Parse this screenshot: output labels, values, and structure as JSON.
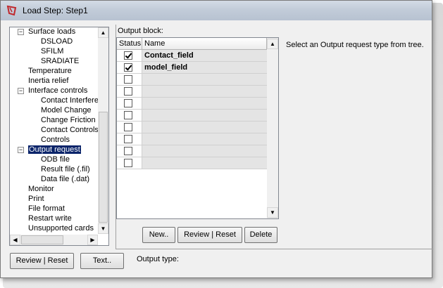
{
  "window": {
    "title": "Load Step: Step1"
  },
  "tree": {
    "items": [
      {
        "label": "Surface loads",
        "expander": "−"
      },
      {
        "label": "DSLOAD"
      },
      {
        "label": "SFILM"
      },
      {
        "label": "SRADIATE"
      },
      {
        "label": "Temperature"
      },
      {
        "label": "Inertia relief"
      },
      {
        "label": "Interface controls",
        "expander": "−"
      },
      {
        "label": "Contact Interfere"
      },
      {
        "label": "Model Change"
      },
      {
        "label": "Change Friction"
      },
      {
        "label": "Contact Controls"
      },
      {
        "label": "Controls"
      },
      {
        "label": "Output request",
        "expander": "−",
        "selected": true
      },
      {
        "label": "ODB file"
      },
      {
        "label": "Result file (.fil)"
      },
      {
        "label": "Data file (.dat)"
      },
      {
        "label": "Monitor"
      },
      {
        "label": "Print"
      },
      {
        "label": "File format"
      },
      {
        "label": "Restart write"
      },
      {
        "label": "Unsupported cards"
      }
    ]
  },
  "output_block": {
    "label": "Output block:",
    "columns": [
      "Status",
      "Name"
    ],
    "rows": [
      {
        "checked": true,
        "name": "Contact_field"
      },
      {
        "checked": true,
        "name": "model_field"
      },
      {
        "checked": false,
        "name": ""
      },
      {
        "checked": false,
        "name": ""
      },
      {
        "checked": false,
        "name": ""
      },
      {
        "checked": false,
        "name": ""
      },
      {
        "checked": false,
        "name": ""
      },
      {
        "checked": false,
        "name": ""
      },
      {
        "checked": false,
        "name": ""
      },
      {
        "checked": false,
        "name": ""
      }
    ]
  },
  "hint": "Select an Output request type from tree.",
  "buttons": {
    "new": "New..",
    "review_reset_grid": "Review | Reset",
    "delete": "Delete",
    "review_reset_main": "Review | Reset",
    "text": "Text.."
  },
  "output_type_label": "Output type:",
  "colors": {
    "selection": "#0a246a",
    "name_cell": "#e4e4e4",
    "title_bar": "#c2ccd9"
  }
}
